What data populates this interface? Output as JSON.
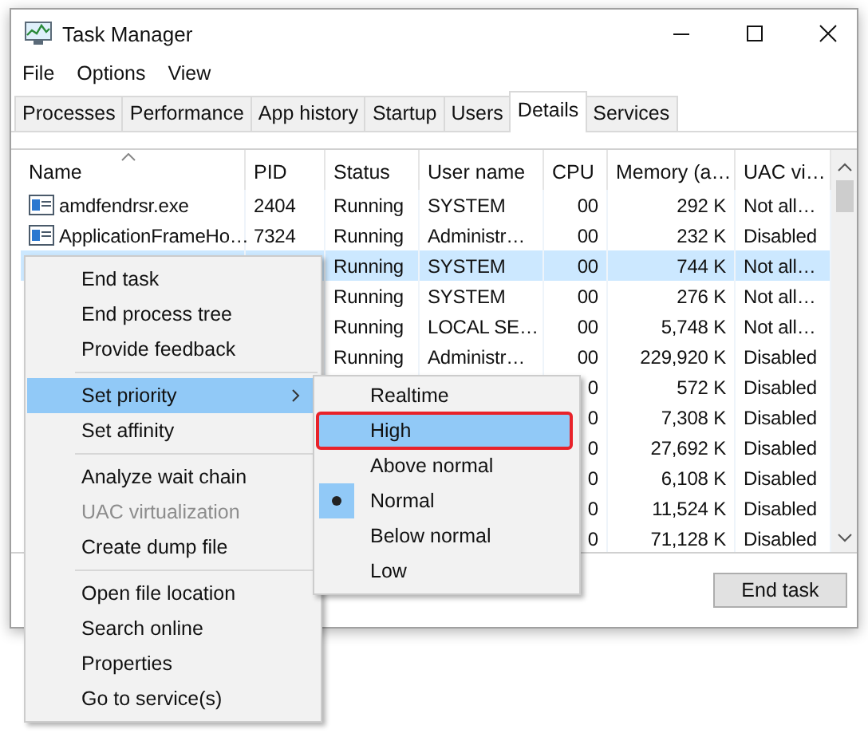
{
  "window": {
    "title": "Task Manager"
  },
  "menu": [
    "File",
    "Options",
    "View"
  ],
  "tabs": [
    {
      "label": "Processes",
      "selected": false
    },
    {
      "label": "Performance",
      "selected": false
    },
    {
      "label": "App history",
      "selected": false
    },
    {
      "label": "Startup",
      "selected": false
    },
    {
      "label": "Users",
      "selected": false
    },
    {
      "label": "Details",
      "selected": true
    },
    {
      "label": "Services",
      "selected": false
    }
  ],
  "table": {
    "columns": [
      "Name",
      "PID",
      "Status",
      "User name",
      "CPU",
      "Memory (a…",
      "UAC vi…"
    ],
    "rows": [
      {
        "selected": false,
        "cells": [
          "amdfendrsr.exe",
          "2404",
          "Running",
          "SYSTEM",
          "00",
          "292 K",
          "Not all…"
        ]
      },
      {
        "selected": false,
        "cells": [
          "ApplicationFrameHo…",
          "7324",
          "Running",
          "Administr…",
          "00",
          "232 K",
          "Disabled"
        ]
      },
      {
        "selected": true,
        "cells": [
          null,
          null,
          "Running",
          "SYSTEM",
          "00",
          "744 K",
          "Not all…"
        ]
      },
      {
        "selected": false,
        "cells": [
          null,
          null,
          "Running",
          "SYSTEM",
          "00",
          "276 K",
          "Not all…"
        ]
      },
      {
        "selected": false,
        "cells": [
          null,
          null,
          "Running",
          "LOCAL SE…",
          "00",
          "5,748 K",
          "Not all…"
        ]
      },
      {
        "selected": false,
        "cells": [
          null,
          null,
          "Running",
          "Administr…",
          "00",
          "229,920 K",
          "Disabled"
        ]
      },
      {
        "selected": false,
        "cells": [
          null,
          null,
          null,
          null,
          "0",
          "572 K",
          "Disabled"
        ]
      },
      {
        "selected": false,
        "cells": [
          null,
          null,
          null,
          null,
          "0",
          "7,308 K",
          "Disabled"
        ]
      },
      {
        "selected": false,
        "cells": [
          null,
          null,
          null,
          null,
          "0",
          "27,692 K",
          "Disabled"
        ]
      },
      {
        "selected": false,
        "cells": [
          null,
          null,
          null,
          null,
          "0",
          "6,108 K",
          "Disabled"
        ]
      },
      {
        "selected": false,
        "cells": [
          null,
          null,
          null,
          null,
          "0",
          "11,524 K",
          "Disabled"
        ]
      },
      {
        "selected": false,
        "cells": [
          null,
          null,
          null,
          null,
          "0",
          "71,128 K",
          "Disabled"
        ]
      }
    ]
  },
  "end_task_button": "End task",
  "context_menu": [
    {
      "kind": "item",
      "label": "End task",
      "disabled": false,
      "selected": false
    },
    {
      "kind": "item",
      "label": "End process tree",
      "disabled": false,
      "selected": false
    },
    {
      "kind": "item",
      "label": "Provide feedback",
      "disabled": false,
      "selected": false
    },
    {
      "kind": "separator"
    },
    {
      "kind": "submenu",
      "label": "Set priority",
      "disabled": false,
      "selected": true
    },
    {
      "kind": "item",
      "label": "Set affinity",
      "disabled": false,
      "selected": false
    },
    {
      "kind": "separator"
    },
    {
      "kind": "item",
      "label": "Analyze wait chain",
      "disabled": false,
      "selected": false
    },
    {
      "kind": "item",
      "label": "UAC virtualization",
      "disabled": true,
      "selected": false
    },
    {
      "kind": "item",
      "label": "Create dump file",
      "disabled": false,
      "selected": false
    },
    {
      "kind": "separator"
    },
    {
      "kind": "item",
      "label": "Open file location",
      "disabled": false,
      "selected": false
    },
    {
      "kind": "item",
      "label": "Search online",
      "disabled": false,
      "selected": false
    },
    {
      "kind": "item",
      "label": "Properties",
      "disabled": false,
      "selected": false
    },
    {
      "kind": "item",
      "label": "Go to service(s)",
      "disabled": false,
      "selected": false
    }
  ],
  "priority_submenu": [
    {
      "label": "Realtime",
      "checked": false,
      "selected": false
    },
    {
      "label": "High",
      "checked": false,
      "selected": true
    },
    {
      "label": "Above normal",
      "checked": false,
      "selected": false
    },
    {
      "label": "Normal",
      "checked": true,
      "selected": false
    },
    {
      "label": "Below normal",
      "checked": false,
      "selected": false
    },
    {
      "label": "Low",
      "checked": false,
      "selected": false
    }
  ]
}
